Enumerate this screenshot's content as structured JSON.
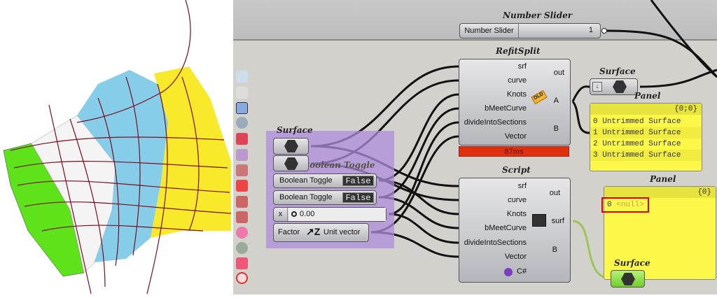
{
  "number_slider": {
    "title": "Number Slider",
    "label": "Number Slider",
    "value": "1"
  },
  "refitsplit": {
    "title": "RefitSplit",
    "inputs": [
      "srf",
      "curve",
      "Knots",
      "bMeetCurve",
      "divideIntoSections",
      "Vector"
    ],
    "outputs": [
      "out",
      "A",
      "B"
    ],
    "badge": "OLD",
    "time": "87ms"
  },
  "surface_top": {
    "title": "Surface"
  },
  "panel1": {
    "title": "Panel",
    "path": "{0;0}",
    "rows": [
      {
        "i": "0",
        "v": "Untrimmed Surface"
      },
      {
        "i": "1",
        "v": "Untrimmed Surface"
      },
      {
        "i": "2",
        "v": "Untrimmed Surface"
      },
      {
        "i": "3",
        "v": "Untrimmed Surface"
      }
    ]
  },
  "group": {
    "surface_title": "Surface",
    "toggle_title": "Boolean Toggle",
    "toggles": [
      {
        "label": "Boolean Toggle",
        "value": "False"
      },
      {
        "label": "Boolean Toggle",
        "value": "False"
      }
    ],
    "slider": {
      "label": "x",
      "value": "0.00"
    },
    "unit_vector": {
      "input": "Factor",
      "output": "Unit vector"
    }
  },
  "script": {
    "title": "Script",
    "inputs": [
      "srf",
      "curve",
      "Knots",
      "bMeetCurve",
      "divideIntoSections",
      "Vector"
    ],
    "outputs": [
      "out",
      "surf",
      "B"
    ],
    "language": "C#"
  },
  "panel2": {
    "title": "Panel",
    "path": "{0}",
    "rows": [
      {
        "i": "0",
        "v": "<null>"
      }
    ]
  },
  "surface_bottom": {
    "title": "Surface"
  },
  "colors": {
    "canvas": "#d3d1cb",
    "group": "#b9a3d8",
    "panel": "#fbf84a",
    "timer": "#e0310f",
    "highlight": "#e00000",
    "wire_green": "#9cc45a"
  }
}
